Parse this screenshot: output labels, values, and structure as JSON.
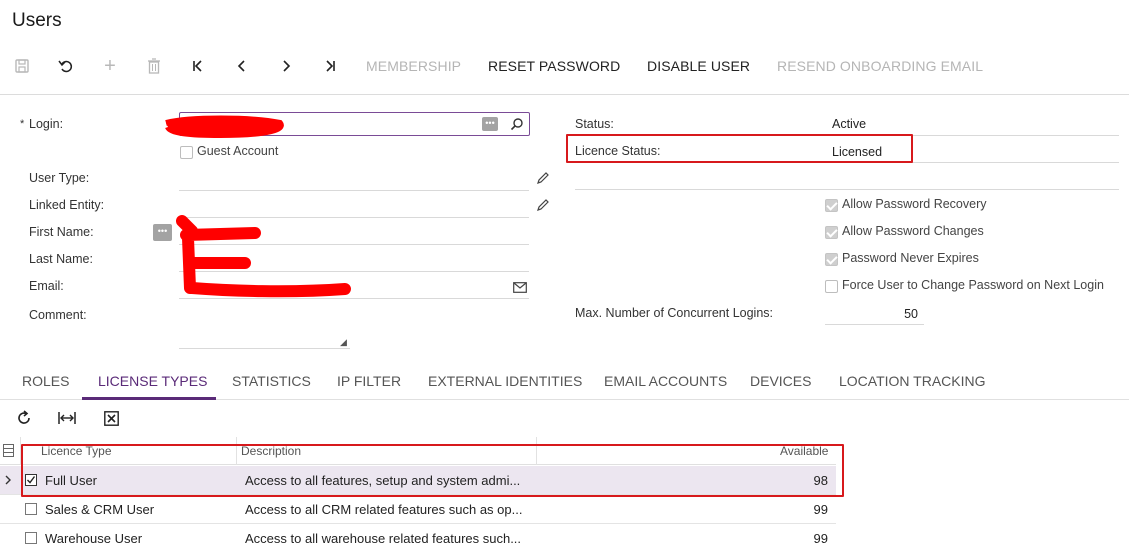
{
  "page": {
    "title": "Users"
  },
  "toolbar": {
    "membership": "MEMBERSHIP",
    "reset_password": "RESET PASSWORD",
    "disable_user": "DISABLE USER",
    "resend_onboarding": "RESEND ONBOARDING EMAIL"
  },
  "form": {
    "login_label": "Login:",
    "required_mark": "*",
    "guest_account": "Guest Account",
    "user_type_label": "User Type:",
    "linked_entity_label": "Linked Entity:",
    "first_name_label": "First Name:",
    "last_name_label": "Last Name:",
    "email_label": "Email:",
    "comment_label": "Comment:",
    "status_label": "Status:",
    "status_value": "Active",
    "licence_status_label": "Licence Status:",
    "licence_status_value": "Licensed",
    "allow_password_recovery": "Allow Password Recovery",
    "allow_password_changes": "Allow Password Changes",
    "password_never_expires": "Password Never Expires",
    "force_change_password": "Force User to Change Password on Next Login",
    "max_logins_label": "Max. Number of Concurrent Logins:",
    "max_logins_value": "50"
  },
  "tabs": [
    "ROLES",
    "LICENSE TYPES",
    "STATISTICS",
    "IP FILTER",
    "EXTERNAL IDENTITIES",
    "EMAIL ACCOUNTS",
    "DEVICES",
    "LOCATION TRACKING"
  ],
  "grid": {
    "headers": {
      "licence_type": "Licence Type",
      "description": "Description",
      "available": "Available"
    },
    "rows": [
      {
        "type": "Full User",
        "description": "Access to all features, setup and system admi...",
        "available": "98",
        "checked": true
      },
      {
        "type": "Sales & CRM User",
        "description": "Access to all CRM related features such as op...",
        "available": "99",
        "checked": false
      },
      {
        "type": "Warehouse User",
        "description": "Access to all warehouse related features such...",
        "available": "99",
        "checked": false
      }
    ]
  },
  "colors": {
    "accent": "#5a2a78",
    "highlight": "#d7191c",
    "redaction": "#ff0000"
  }
}
